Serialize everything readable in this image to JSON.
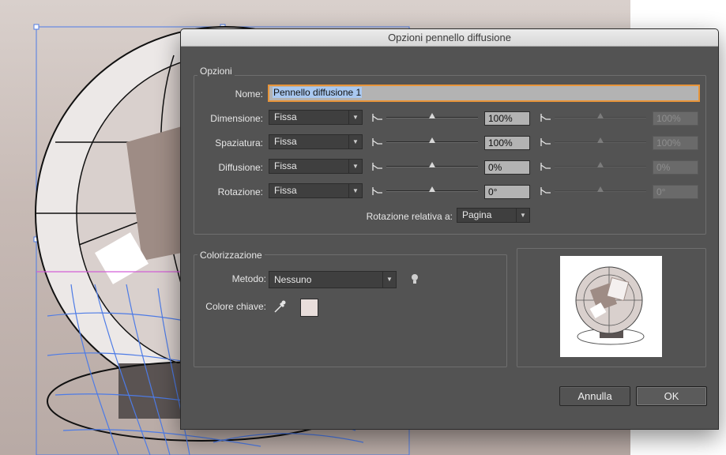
{
  "dialog": {
    "title": "Opzioni pennello diffusione"
  },
  "options": {
    "group_title": "Opzioni",
    "name_label": "Nome:",
    "name_value": "Pennello diffusione 1",
    "rows": [
      {
        "label": "Dimensione:",
        "mode": "Fissa",
        "value": "100%",
        "value2": "100%",
        "slider": 0.5
      },
      {
        "label": "Spaziatura:",
        "mode": "Fissa",
        "value": "100%",
        "value2": "100%",
        "slider": 0.5
      },
      {
        "label": "Diffusione:",
        "mode": "Fissa",
        "value": "0%",
        "value2": "0%",
        "slider": 0.5
      },
      {
        "label": "Rotazione:",
        "mode": "Fissa",
        "value": "0°",
        "value2": "0°",
        "slider": 0.5
      }
    ],
    "rotation_relative_label": "Rotazione relativa a:",
    "rotation_relative_value": "Pagina"
  },
  "colorization": {
    "group_title": "Colorizzazione",
    "method_label": "Metodo:",
    "method_value": "Nessuno",
    "key_color_label": "Colore chiave:",
    "key_color": "#e9dedb"
  },
  "buttons": {
    "cancel_label": "Annulla",
    "ok_label": "OK"
  },
  "colors": {
    "dialog_bg": "#535353",
    "name_focus": "#e8953a",
    "selection_blue": "#4a7ee0",
    "text_highlight": "#a9c8f0"
  }
}
